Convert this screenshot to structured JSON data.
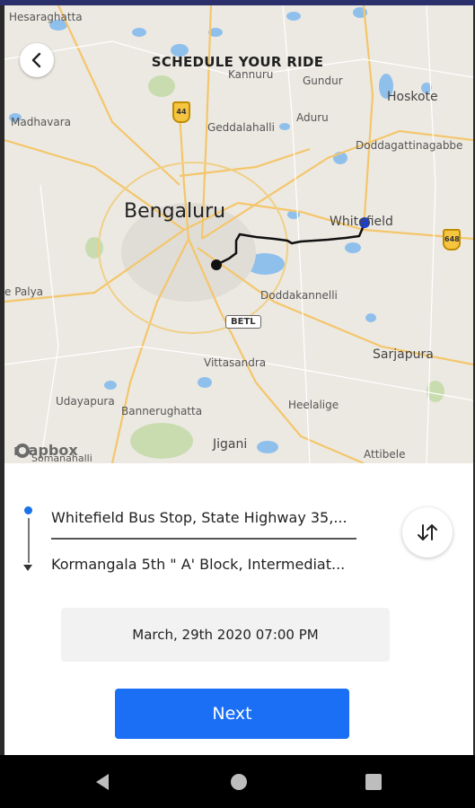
{
  "header": {
    "title": "SCHEDULE YOUR RIDE",
    "back_icon": "chevron-left-icon"
  },
  "map": {
    "labels": {
      "hesaraghatta": "Hesaraghatta",
      "kannuru": "Kannuru",
      "gundur": "Gundur",
      "hoskote": "Hoskote",
      "madhavara": "Madhavara",
      "geddalahalli": "Geddalahalli",
      "aduru": "Aduru",
      "doddagattinagabbe": "Doddagattinagabbe",
      "bengaluru": "Bengaluru",
      "whitefield": "Whitefield",
      "palya": "e Palya",
      "doddakannelli": "Doddakannelli",
      "sarjapura": "Sarjapura",
      "vittasandra": "Vittasandra",
      "udayapura": "Udayapura",
      "heelalige": "Heelalige",
      "bannerughatta": "Bannerughatta",
      "jigani": "Jigani",
      "attibele": "Attibele",
      "somanahalli": "Somanahalli"
    },
    "shields": {
      "nh44": "44",
      "nh648": "648"
    },
    "betl": "BETL",
    "attribution": "mapbox",
    "colors": {
      "route": "#111111",
      "origin": "#1a40d8",
      "water": "#7fb6e8",
      "road": "#f6c86a"
    }
  },
  "trip": {
    "from_value": "Whitefield Bus Stop, State Highway 35,...",
    "to_value": "Kormangala 5th \" A' Block, Intermediat...",
    "swap_icon": "swap-vertical-icon",
    "datetime": "March, 29th 2020 07:00 PM"
  },
  "actions": {
    "next_label": "Next",
    "accent": "#1a6ff5"
  },
  "navbar": {
    "back_icon": "triangle-back-icon",
    "home_icon": "circle-home-icon",
    "recents_icon": "square-recents-icon"
  }
}
